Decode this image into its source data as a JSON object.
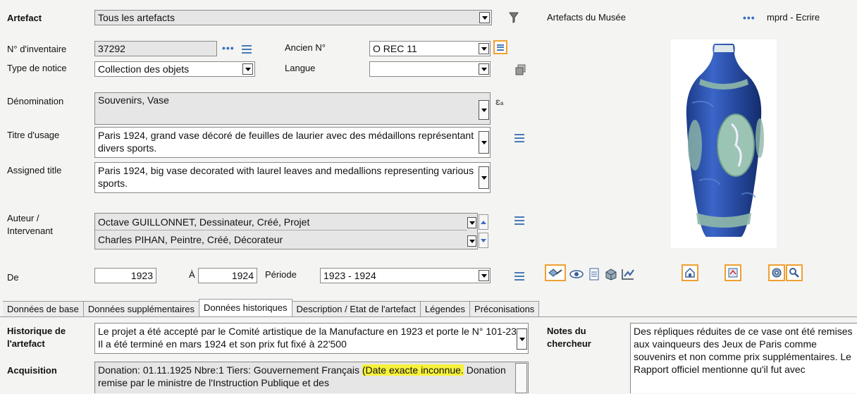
{
  "header": {
    "artefact_label": "Artefact",
    "artefact_value": "Tous les artefacts",
    "museum_label": "Artefacts du Musée",
    "user_label": "mprd - Ecrire",
    "more_dots": "•••"
  },
  "form": {
    "inventory_label": "N° d'inventaire",
    "inventory_value": "37292",
    "old_number_label": "Ancien N°",
    "old_number_value": "O REC 11",
    "notice_type_label": "Type de notice",
    "notice_type_value": "Collection des objets",
    "language_label": "Langue",
    "language_value": "",
    "denomination_label": "Dénomination",
    "denomination_value": "Souvenirs, Vase",
    "title_usage_label": "Titre d'usage",
    "title_usage_value": "Paris 1924, grand vase décoré de feuilles de laurier avec des médaillons représentant divers sports.",
    "assigned_title_label": "Assigned title",
    "assigned_title_value": "Paris 1924, big vase decorated with laurel leaves and medallions representing various sports.",
    "author_label_1": "Auteur /",
    "author_label_2": "Intervenant",
    "authors": [
      "Octave GUILLONNET, Dessinateur, Créé, Projet",
      "Charles PIHAN, Peintre, Créé, Décorateur"
    ],
    "from_label": "De",
    "from_value": "1923",
    "to_label": "À",
    "to_value": "1924",
    "period_label": "Période",
    "period_value": "1923 - 1924"
  },
  "tabs": [
    "Données de base",
    "Données supplémentaires",
    "Données historiques",
    "Description / Etat de l'artefact",
    "Légendes",
    "Préconisations"
  ],
  "history": {
    "history_label_1": "Historique de",
    "history_label_2": "l'artefact",
    "history_value": "Le projet a été accepté par le Comité artistique de la Manufacture en 1923 et porte le N° 101-23. Il a été terminé en mars 1924 et son prix fut fixé à 22'500",
    "acquisition_label": "Acquisition",
    "acquisition_part1": "Donation: 01.11.1925 Nbre:1 Tiers: Gouvernement Français ",
    "acquisition_highlight": "(Date exacte inconnue.",
    "acquisition_part2": " Donation remise par le ministre de l'Instruction Publique et des",
    "notes_label_1": "Notes du",
    "notes_label_2": "chercheur",
    "notes_value": "Des répliques réduites de ce vase ont été remises aux vainqueurs des Jeux de Paris comme souvenirs et non comme prix supplémentaires. Le Rapport officiel mentionne qu'il fut avec"
  },
  "icons": {
    "filter": "filter-icon",
    "duplicate": "duplicate-icon",
    "translate": "translate-icon"
  },
  "colors": {
    "accent_orange": "#f0a030",
    "link_blue": "#3a6fc4",
    "highlight": "#f6f23a"
  }
}
